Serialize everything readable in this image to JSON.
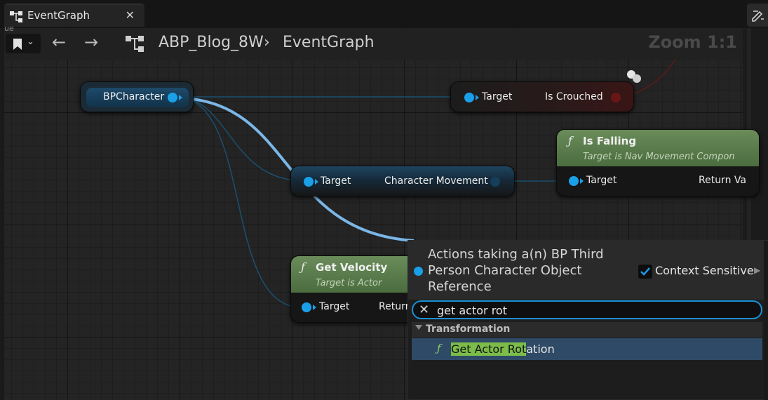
{
  "tab": {
    "title": "EventGraph",
    "close": "✕"
  },
  "crumbs": {
    "asset": "ABP_Blog_8W",
    "separator": "›",
    "graph": "EventGraph",
    "zoom": "Zoom 1:1"
  },
  "side_label": "ue",
  "nodes": {
    "bpcharacter": {
      "label": "BPCharacter"
    },
    "is_crouched": {
      "target": "Target",
      "output": "Is Crouched"
    },
    "char_movement": {
      "target": "Target",
      "output": "Character Movement"
    },
    "is_falling": {
      "title": "Is Falling",
      "subtitle": "Target is Nav Movement Compon",
      "target": "Target",
      "output": "Return Va"
    },
    "get_velocity": {
      "title": "Get Velocity",
      "subtitle": "Target is Actor",
      "target": "Target",
      "output": "Return"
    }
  },
  "popup": {
    "title": "Actions taking a(n) BP Third Person Character Object Reference",
    "context_sensitive": "Context Sensitive",
    "context_checked": true,
    "search_value": "get actor rot",
    "category": "Transformation",
    "result_match": "Get Actor Rot",
    "result_rest": "ation"
  },
  "colors": {
    "object_pin": "#1aa0e8",
    "func_header": "#5d7f4e",
    "bool_pin": "#8a1a1a",
    "selection": "#2f4a66",
    "highlight": "#7cbd4a"
  },
  "icons": [
    "graph-tab-icon",
    "bookmark-icon",
    "back-arrow-icon",
    "forward-arrow-icon",
    "graph-icon",
    "function-icon",
    "check-icon",
    "close-icon",
    "edit-icon"
  ]
}
